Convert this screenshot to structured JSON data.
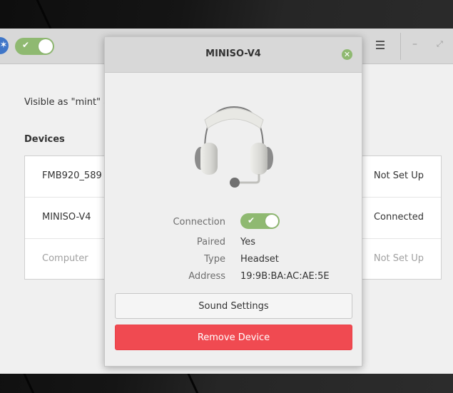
{
  "header": {
    "bluetooth_enabled": true,
    "menu_icon": "hamburger-menu-icon",
    "minimize_icon": "minimize-icon",
    "maximize_icon": "maximize-icon"
  },
  "main": {
    "visible_as": "Visible as \"mint\" a",
    "devices_heading": "Devices",
    "devices": [
      {
        "name": "FMB920_589",
        "status": "Not Set Up",
        "dimmed": false
      },
      {
        "name": "MINISO-V4",
        "status": "Connected",
        "dimmed": false
      },
      {
        "name": "Computer",
        "status": "Not Set Up",
        "dimmed": true
      }
    ]
  },
  "dialog": {
    "title": "MINISO-V4",
    "close_icon": "close-icon",
    "device_icon": "headset-icon",
    "connection_label": "Connection",
    "connection_on": true,
    "paired_label": "Paired",
    "paired_value": "Yes",
    "type_label": "Type",
    "type_value": "Headset",
    "address_label": "Address",
    "address_value": "19:9B:BA:AC:AE:5E",
    "sound_settings_label": "Sound Settings",
    "remove_device_label": "Remove Device"
  },
  "colors": {
    "accent_green": "#8fb971",
    "destructive_red": "#f04a51",
    "bluetooth_blue": "#3f76c8"
  }
}
